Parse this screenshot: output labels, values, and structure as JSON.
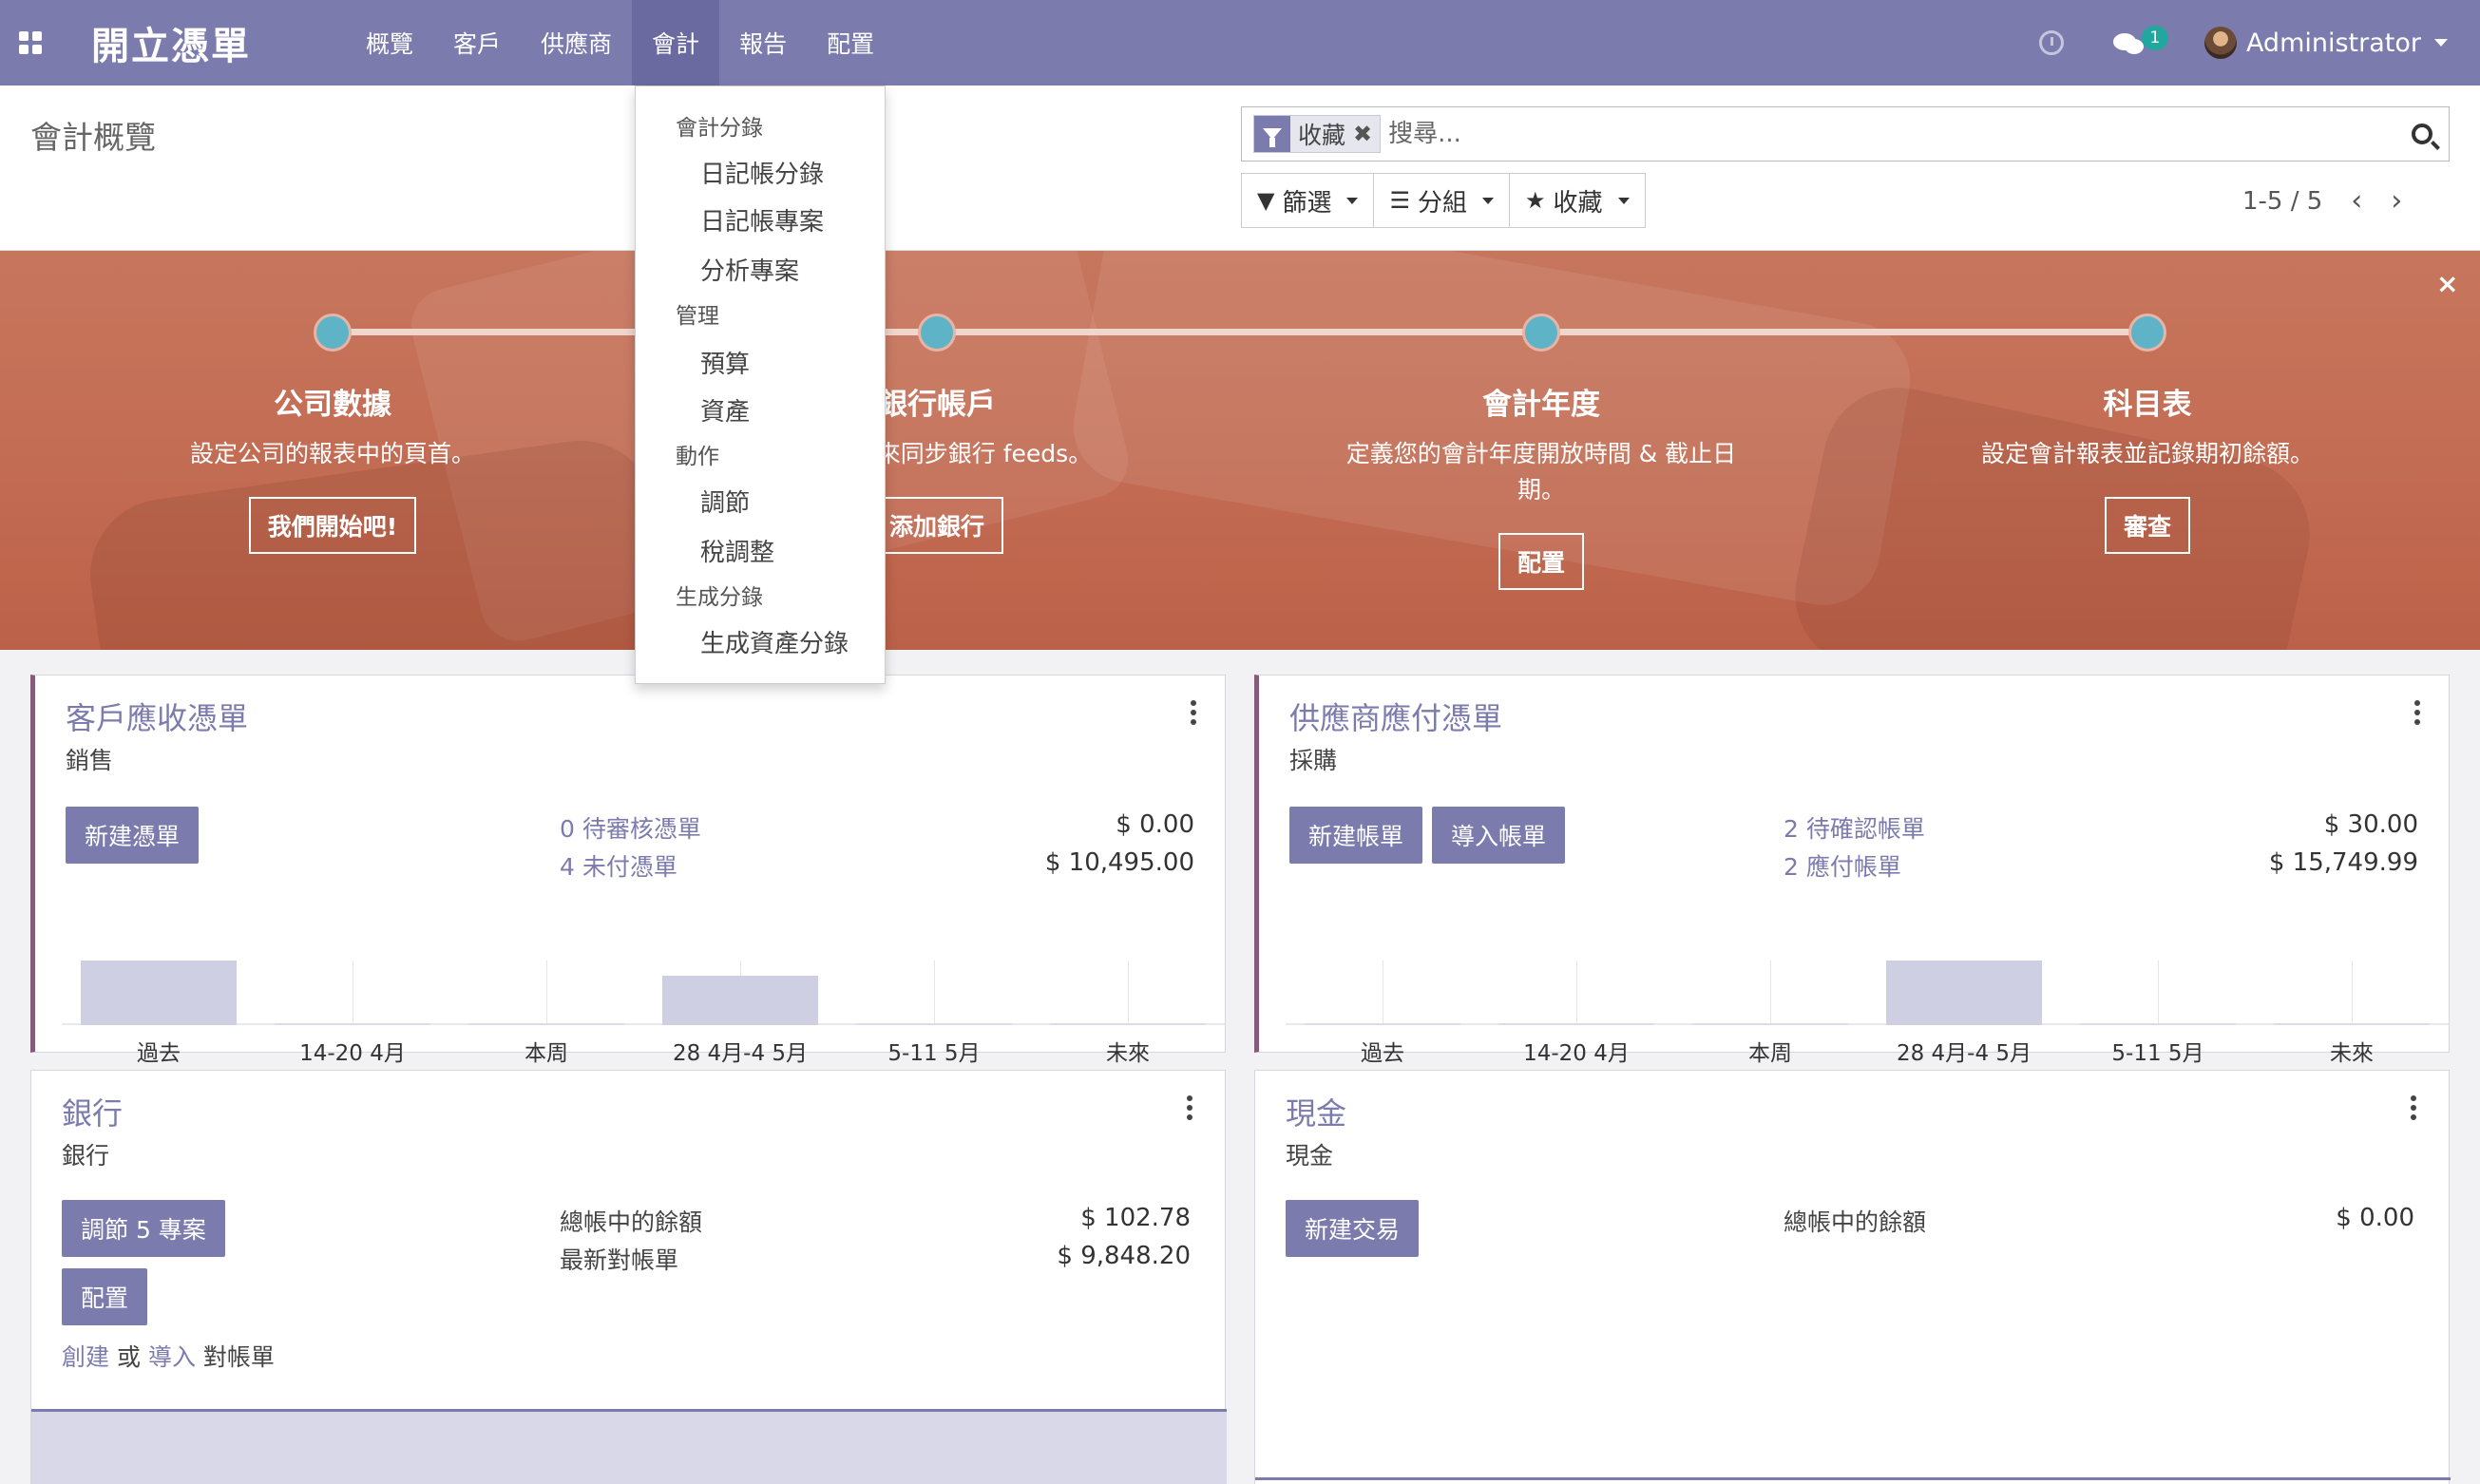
{
  "navbar": {
    "brand": "開立憑單",
    "menu": [
      "概覽",
      "客戶",
      "供應商",
      "會計",
      "報告",
      "配置"
    ],
    "active_menu": "會計",
    "chat_count": "1",
    "user": "Administrator"
  },
  "control_panel": {
    "title": "會計概覽",
    "facet_label": "收藏",
    "facet_remove": "✖",
    "search_placeholder": "搜尋...",
    "filters_label": "篩選",
    "group_label": "分組",
    "favorites_label": "收藏",
    "pager": "1-5 / 5",
    "prev": "‹",
    "next": "›"
  },
  "dropdown": {
    "sections": [
      {
        "header": "會計分錄",
        "items": [
          "日記帳分錄",
          "日記帳專案",
          "分析專案"
        ]
      },
      {
        "header": "管理",
        "items": [
          "預算",
          "資產"
        ]
      },
      {
        "header": "動作",
        "items": [
          "調節",
          "稅調整"
        ]
      },
      {
        "header": "生成分錄",
        "items": [
          "生成資產分錄"
        ]
      }
    ]
  },
  "banner": {
    "close": "×",
    "steps": [
      {
        "title": "公司數據",
        "text": "設定公司的報表中的頁首。",
        "button": "我們開始吧!"
      },
      {
        "title": "銀行帳戶",
        "text": "銀行科目來同步銀行 feeds。",
        "button": "添加銀行"
      },
      {
        "title": "會計年度",
        "text": "定義您的會計年度開放時間 & 截止日期。",
        "button": "配置"
      },
      {
        "title": "科目表",
        "text": "設定會計報表並記錄期初餘額。",
        "button": "審查"
      }
    ]
  },
  "cards": {
    "customer": {
      "title": "客戶應收憑單",
      "subtitle": "銷售",
      "button": "新建憑單",
      "link1": "0 待審核憑單",
      "link2": "4 未付憑單",
      "amount1": "$ 0.00",
      "amount2": "$ 10,495.00"
    },
    "vendor": {
      "title": "供應商應付憑單",
      "subtitle": "採購",
      "button1": "新建帳單",
      "button2": "導入帳單",
      "link1": "2 待確認帳單",
      "link2": "2 應付帳單",
      "amount1": "$ 30.00",
      "amount2": "$ 15,749.99"
    },
    "bank": {
      "title": "銀行",
      "subtitle": "銀行",
      "button1": "調節 5 專案",
      "button2": "配置",
      "label1": "總帳中的餘額",
      "label2": "最新對帳單",
      "amount1": "$ 102.78",
      "amount2": "$ 9,848.20",
      "create": "創建",
      "or": "或",
      "import": "導入",
      "statement": "對帳單"
    },
    "cash": {
      "title": "現金",
      "subtitle": "現金",
      "button": "新建交易",
      "label1": "總帳中的餘額",
      "amount1": "$ 0.00"
    }
  },
  "chart_data": [
    {
      "type": "bar",
      "categories": [
        "過去",
        "14-20 4月",
        "本周",
        "28 4月-4 5月",
        "5-11 5月",
        "未來"
      ],
      "values": [
        10495,
        0,
        0,
        8000,
        0,
        0
      ]
    },
    {
      "type": "bar",
      "categories": [
        "過去",
        "14-20 4月",
        "本周",
        "28 4月-4 5月",
        "5-11 5月",
        "未來"
      ],
      "values": [
        0,
        0,
        0,
        15749.99,
        0,
        0
      ]
    }
  ],
  "colors": {
    "primary": "#7c7bad",
    "banner": "#c26b52",
    "accent": "#875a7b",
    "step_dot": "#5fb3c6"
  }
}
